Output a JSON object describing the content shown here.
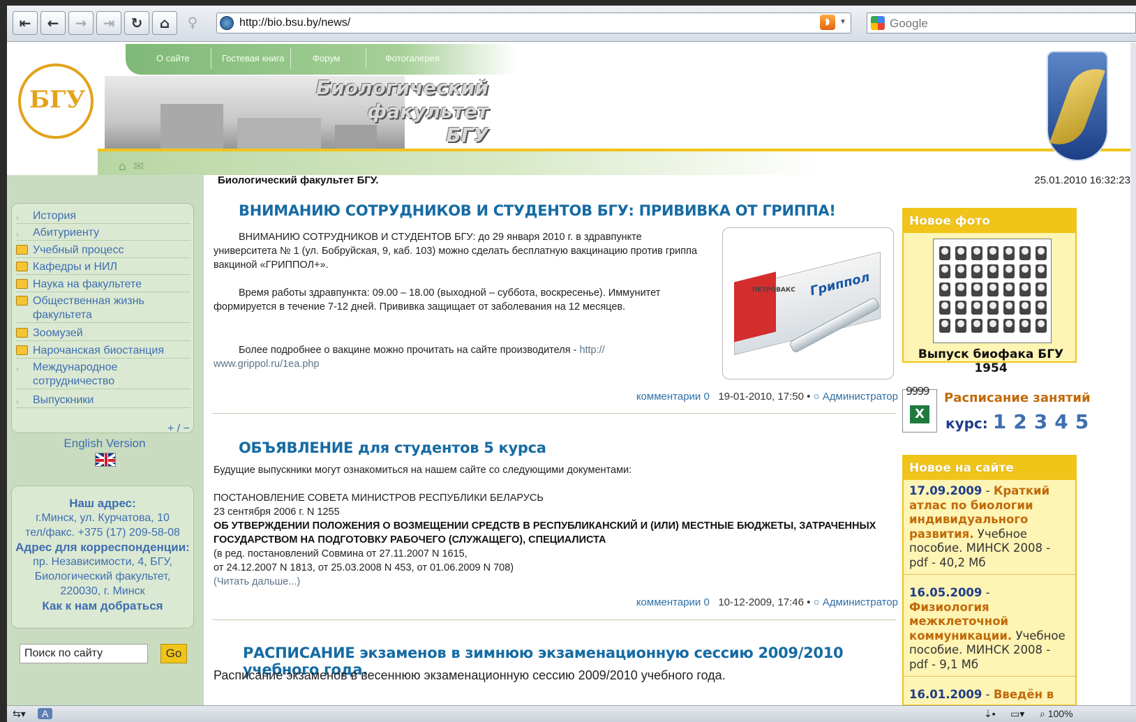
{
  "browser": {
    "url": "http://bio.bsu.by/news/",
    "search_placeholder": "Google",
    "zoom": "100%",
    "status_left": "A"
  },
  "header": {
    "nav": [
      "О сайте",
      "Гостевая книга",
      "Форум",
      "Фотогалерея"
    ],
    "title_lines": [
      "Биологический",
      "факультет",
      "БГУ"
    ],
    "logo_text": "БГУ"
  },
  "subheader": {
    "site_name": "Биологический факультет БГУ.",
    "datetime": "25.01.2010 16:32:23"
  },
  "menu": [
    {
      "label": "История",
      "icon": "arrow"
    },
    {
      "label": "Абитуриенту",
      "icon": "arrow"
    },
    {
      "label": "Учебный процесс",
      "icon": "folder"
    },
    {
      "label": "Кафедры и НИЛ",
      "icon": "folder"
    },
    {
      "label": "Наука на факультете",
      "icon": "folder"
    },
    {
      "label": "Общественная жизнь факультета",
      "icon": "folder"
    },
    {
      "label": "Зоомузей",
      "icon": "folder"
    },
    {
      "label": "Нарочанская биостанция",
      "icon": "folder"
    },
    {
      "label": "Международное сотрудничество",
      "icon": "arrow"
    },
    {
      "label": "Выпускники",
      "icon": "arrow"
    }
  ],
  "sidebar": {
    "plus_minus": "+ / −",
    "english": "English Version",
    "address_title": "Наш адрес:",
    "address_lines": [
      "г.Минск, ул. Курчатова, 10",
      "тел/факс. +375 (17) 209-58-08"
    ],
    "corr_title": "Адрес для корреспонденции:",
    "corr_lines": [
      "пр. Независимости, 4, БГУ,",
      "Биологический факультет,",
      "220030, г. Минск"
    ],
    "route_link": "Как к нам добраться",
    "search_value": "Поиск по сайту",
    "go_label": "Go"
  },
  "articles": [
    {
      "title": "ВНИМАНИЮ СОТРУДНИКОВ И СТУДЕНТОВ БГУ: ПРИВИВКА ОТ ГРИППА!",
      "p1_lines": [
        "ВНИМАНИЮ СОТРУДНИКОВ И СТУДЕНТОВ БГУ: до 29 января 2010 г. в здравпункте",
        "университета № 1 (ул. Бобруйская, 9, каб. 103) можно сделать бесплатную вакцинацию против гриппа",
        "вакциной «ГРИППОЛ+»."
      ],
      "p2_lines": [
        "Время работы здравпункта: 09.00 – 18.00 (выходной – суббота, воскресенье). Иммунитет",
        "формируется в течение 7-12 дней. Прививка защищает от заболевания на 12 месяцев."
      ],
      "p3_text": "Более подробнее о вакцине можно прочитать на сайте производителя - ",
      "p3_link1": "http://",
      "p3_link2": "www.grippol.ru/1ea.php",
      "image_label": "Гриппол",
      "image_brand": "ПЕТРОВАКС",
      "comments": "комментарии 0",
      "date": "19-01-2010, 17:50",
      "author": "Администратор"
    },
    {
      "title": "ОБЪЯВЛЕНИЕ для студентов 5 курса",
      "intro": "Будущие выпускники могут ознакомиться на нашем сайте со следующими документами:",
      "doc1": "ПОСТАНОВЛЕНИЕ СОВЕТА МИНИСТРОВ РЕСПУБЛИКИ БЕЛАРУСЬ",
      "doc2": "23 сентября 2006 г. N 1255",
      "doc3_lines": [
        "ОБ УТВЕРЖДЕНИИ ПОЛОЖЕНИЯ О ВОЗМЕЩЕНИИ СРЕДСТВ В РЕСПУБЛИКАНСКИЙ И (ИЛИ) МЕСТНЫЕ БЮДЖЕТЫ, ЗАТРАЧЕННЫХ",
        "ГОСУДАРСТВОМ НА ПОДГОТОВКУ РАБОЧЕГО (СЛУЖАЩЕГО), СПЕЦИАЛИСТА"
      ],
      "doc4": "(в ред. постановлений Совмина от 27.11.2007 N 1615,",
      "doc5": "от 24.12.2007 N 1813, от 25.03.2008 N 453, от 01.06.2009 N 708)",
      "read_more": "(Читать дальше...)",
      "comments": "комментарии 0",
      "date": "10-12-2009, 17:46",
      "author": "Администратор"
    },
    {
      "title": "РАСПИСАНИЕ экзаменов в зимнюю экзаменационную сессию 2009/2010 учебного года.",
      "intro": "Расписание экзаменов в весеннюю экзаменационную сессию 2009/2010 учебного года."
    }
  ],
  "right": {
    "new_photo_title": "Новое фото",
    "photo_caption": "Выпуск биофака БГУ 1954",
    "schedule_title": "Расписание занятий",
    "schedule_kurs": "курс:",
    "courses": [
      "1",
      "2",
      "3",
      "4",
      "5"
    ],
    "news_title": "Новое на сайте",
    "news": [
      {
        "date": "17.09.2009",
        "title": "Краткий атлас по биологии индивидуального развития.",
        "rest": "Учебное пособие. МИНСК 2008 - pdf - 40,2 Мб"
      },
      {
        "date": "16.05.2009",
        "title": "Физиология межклеточной коммуникации.",
        "rest": "Учебное пособие. МИНСК 2008 - pdf - 9,1 Мб"
      },
      {
        "date": "16.01.2009",
        "title": "Введён в",
        "rest": ""
      }
    ]
  },
  "colors": {
    "accent_green": "#7fb977",
    "link_blue": "#3f6eaf",
    "title_blue": "#166ba3",
    "yellow": "#f0c419",
    "orange": "#c06a0a"
  }
}
